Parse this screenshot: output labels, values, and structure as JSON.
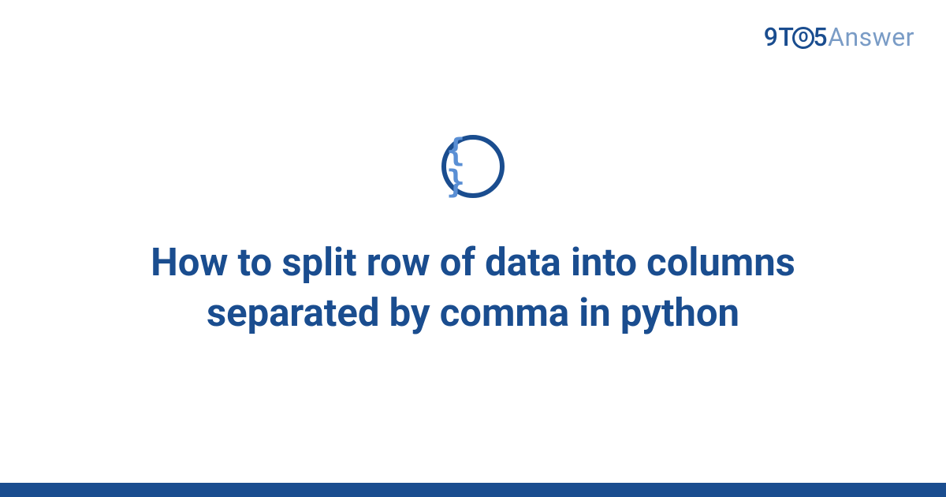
{
  "logo": {
    "part1": "9T",
    "circle": "O",
    "part2": "5",
    "part3": "Answer"
  },
  "icon": {
    "glyph": "{ }"
  },
  "title": "How to split row of data into columns separated by comma in python"
}
